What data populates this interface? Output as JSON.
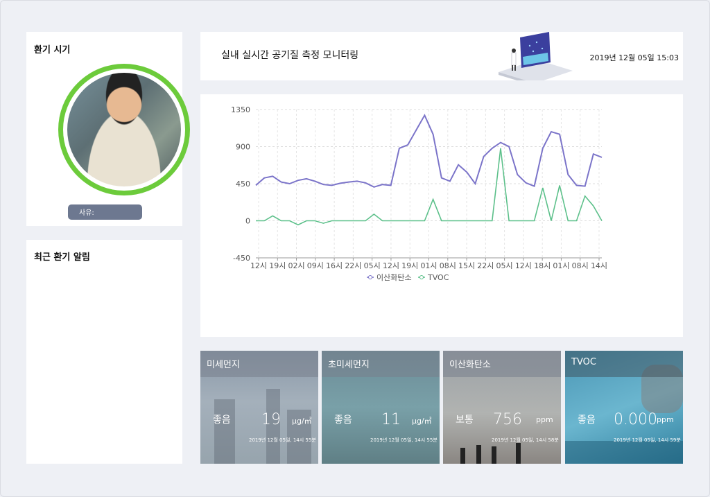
{
  "ventilation": {
    "title": "환기 시기",
    "reason_label": "사유:"
  },
  "recent": {
    "title": "최근 환기 알림"
  },
  "header": {
    "title": "실내 실시간 공기질 측정 모니터링",
    "datetime": "2019년 12월 05일 15:03"
  },
  "chart_data": {
    "type": "line",
    "title": "",
    "xlabel": "",
    "ylabel": "",
    "ylim": [
      -450,
      1350
    ],
    "yticks": [
      1350,
      900,
      450,
      0,
      -450
    ],
    "categories": [
      "12시",
      "19시",
      "02시",
      "09시",
      "16시",
      "22시",
      "05시",
      "12시",
      "19시",
      "01시",
      "08시",
      "15시",
      "22시",
      "05시",
      "12시",
      "18시",
      "01시",
      "08시",
      "14시"
    ],
    "grid": true,
    "legend": "bottom",
    "series": [
      {
        "name": "이산화탄소",
        "color": "#7b74c9",
        "values": [
          430,
          520,
          540,
          470,
          450,
          490,
          510,
          480,
          440,
          430,
          455,
          470,
          480,
          460,
          410,
          440,
          430,
          880,
          920,
          1100,
          1280,
          1050,
          520,
          480,
          680,
          590,
          450,
          780,
          880,
          950,
          900,
          560,
          460,
          420,
          880,
          1080,
          1050,
          560,
          430,
          420,
          810,
          770
        ]
      },
      {
        "name": "TVOC",
        "color": "#5cc08a",
        "values": [
          0,
          0,
          60,
          0,
          0,
          -50,
          0,
          0,
          -30,
          0,
          0,
          0,
          0,
          0,
          80,
          0,
          0,
          0,
          0,
          0,
          0,
          260,
          0,
          0,
          0,
          0,
          0,
          0,
          0,
          880,
          0,
          0,
          0,
          0,
          400,
          0,
          430,
          0,
          0,
          300,
          180,
          0
        ]
      }
    ]
  },
  "cards": [
    {
      "name": "미세먼지",
      "status": "좋음",
      "value": "19",
      "unit": "μg/㎥",
      "time": "2019년 12월 05일, 14시 55분"
    },
    {
      "name": "초미세먼지",
      "status": "좋음",
      "value": "11",
      "unit": "μg/㎥",
      "time": "2019년 12월 05일, 14시 55분"
    },
    {
      "name": "이산화탄소",
      "status": "보통",
      "value": "756",
      "unit": "ppm",
      "time": "2019년 12월 05일, 14시 58분"
    },
    {
      "name": "TVOC",
      "status": "좋음",
      "value": "0.000",
      "unit": "ppm",
      "time": "2019년 12월 05일, 14시 59분"
    }
  ]
}
